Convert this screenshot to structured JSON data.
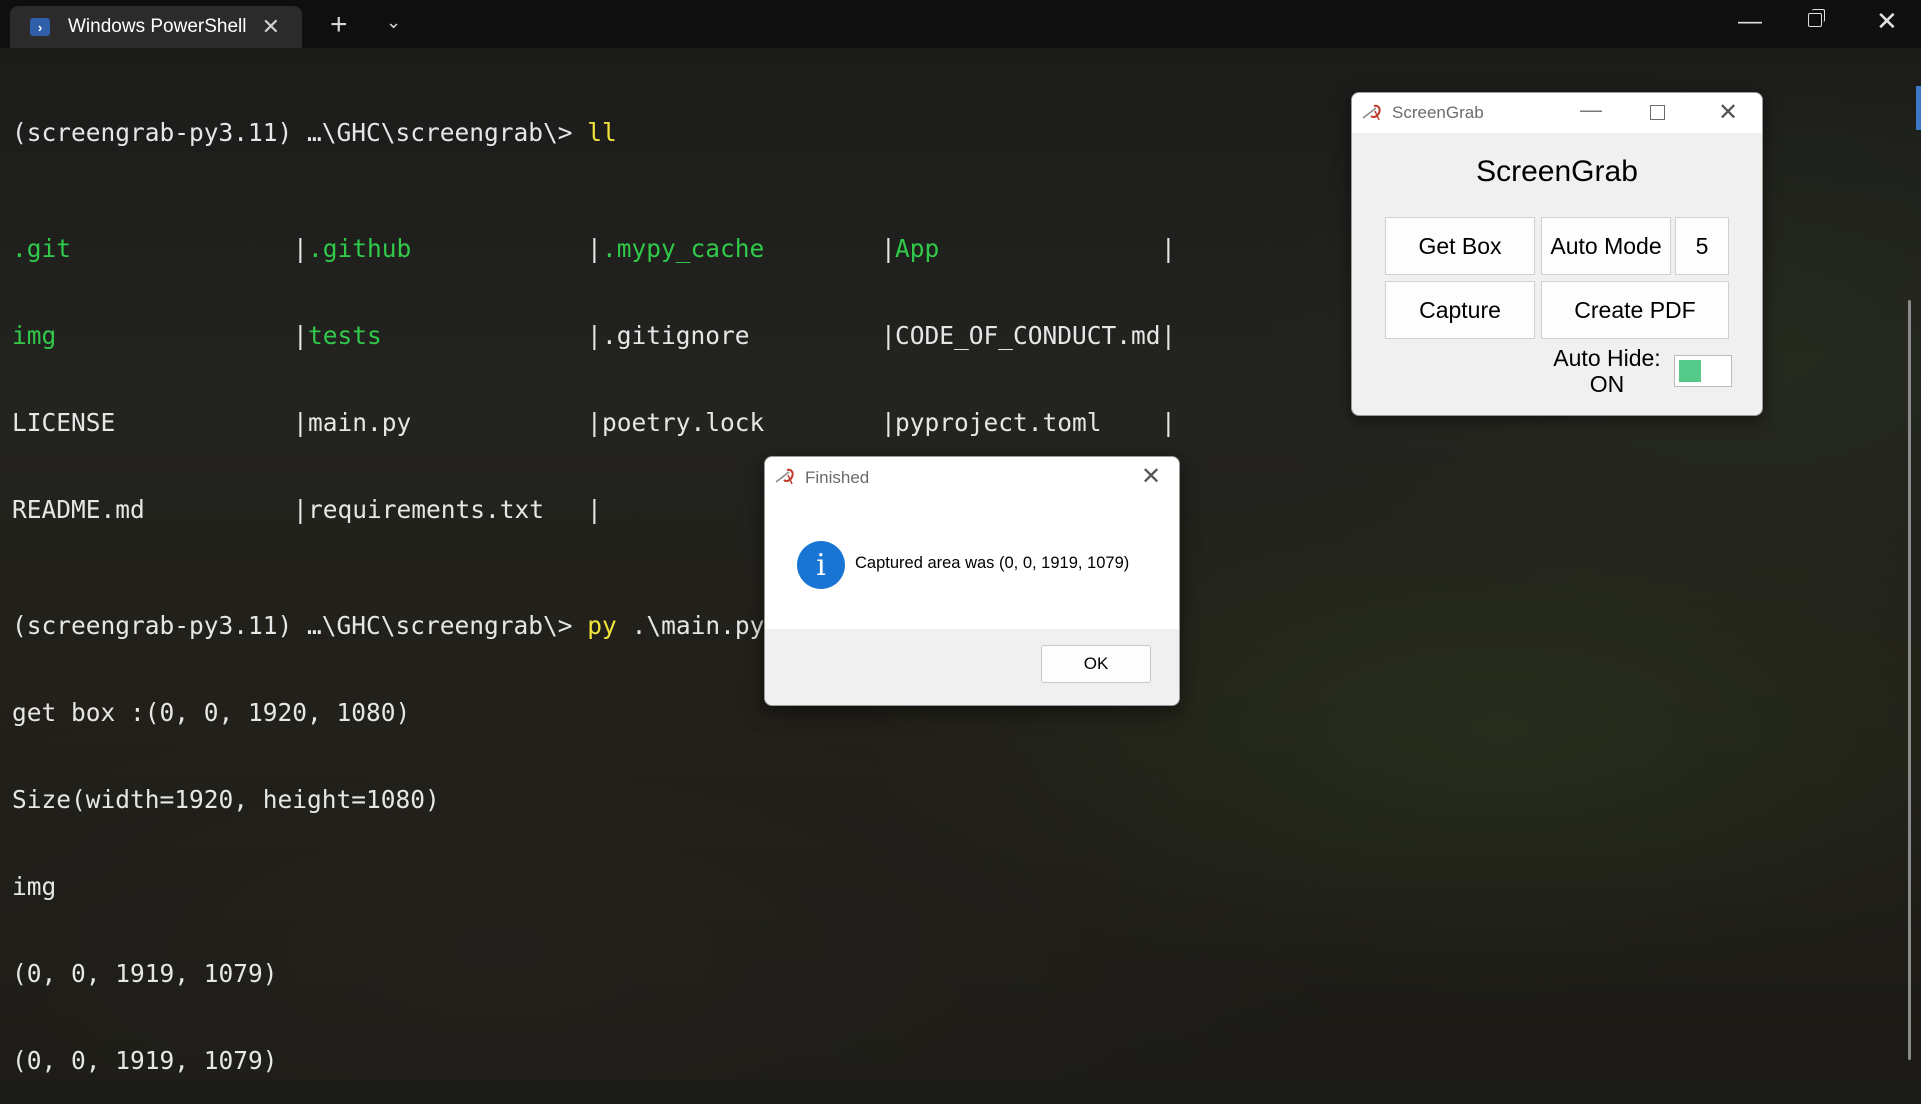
{
  "window": {
    "tab_title": "Windows PowerShell",
    "tab_icon": "powershell-icon",
    "new_tab": "+",
    "dropdown": "⌄",
    "minimize": "—",
    "close": "✕"
  },
  "terminal": {
    "prompt": "(screengrab-py3.11) …\\GHC\\screengrab\\>",
    "cmd1": "ll",
    "cmd2": "py",
    "cmd2_arg": ".\\main.py",
    "ls": [
      [
        ".git",
        ".github",
        ".mypy_cache",
        "App"
      ],
      [
        "img",
        "tests",
        ".gitignore",
        "CODE_OF_CONDUCT.md"
      ],
      [
        "LICENSE",
        "main.py",
        "poetry.lock",
        "pyproject.toml"
      ],
      [
        "README.md",
        "requirements.txt",
        "",
        ""
      ]
    ],
    "sep": "|",
    "output": [
      "get box :(0, 0, 1920, 1080)",
      "Size(width=1920, height=1080)",
      "img",
      "(0, 0, 1919, 1079)",
      "(0, 0, 1919, 1079)"
    ]
  },
  "screengrab": {
    "title": "ScreenGrab",
    "heading": "ScreenGrab",
    "get_box": "Get Box",
    "auto_mode": "Auto Mode",
    "interval": "5",
    "capture": "Capture",
    "create_pdf": "Create PDF",
    "auto_hide_label": "Auto Hide:",
    "auto_hide_state": "ON",
    "toggle_color": "#55c98a"
  },
  "dialog": {
    "title": "Finished",
    "message": "Captured area was (0, 0, 1919, 1079)",
    "ok": "OK",
    "icon": "info-icon",
    "icon_glyph": "i"
  }
}
